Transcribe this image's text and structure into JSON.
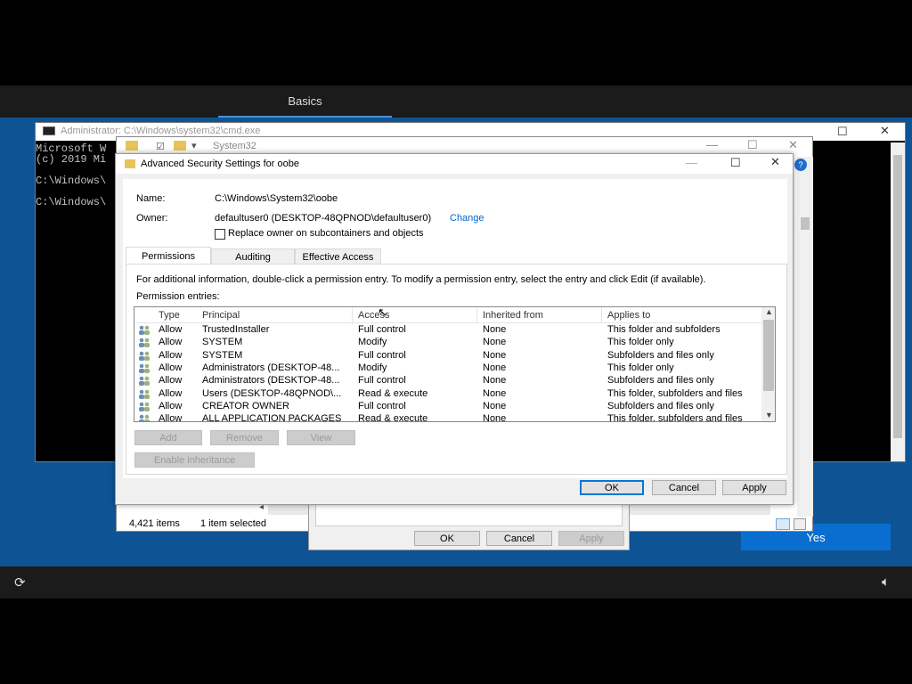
{
  "oobe": {
    "tab_label": "Basics",
    "yes_label": "Yes"
  },
  "cmd": {
    "title": "Administrator: C:\\Windows\\system32\\cmd.exe",
    "lines": [
      "Microsoft W",
      "(c) 2019 Mi",
      "",
      "C:\\Windows\\",
      "",
      "C:\\Windows\\"
    ]
  },
  "explorer": {
    "path": "System32",
    "status_items": "4,421 items",
    "status_selected": "1 item selected"
  },
  "props_dialog": {
    "ok": "OK",
    "cancel": "Cancel",
    "apply": "Apply"
  },
  "adv": {
    "title": "Advanced Security Settings for oobe",
    "name_label": "Name:",
    "name_value": "C:\\Windows\\System32\\oobe",
    "owner_label": "Owner:",
    "owner_value": "defaultuser0 (DESKTOP-48QPNOD\\defaultuser0)",
    "change_link": "Change",
    "replace_owner_label": "Replace owner on subcontainers and objects",
    "tabs": [
      "Permissions",
      "Auditing",
      "Effective Access"
    ],
    "info_text": "For additional information, double-click a permission entry. To modify a permission entry, select the entry and click Edit (if available).",
    "entries_label": "Permission entries:",
    "columns": [
      "Type",
      "Principal",
      "Access",
      "Inherited from",
      "Applies to"
    ],
    "rows": [
      [
        "Allow",
        "TrustedInstaller",
        "Full control",
        "None",
        "This folder and subfolders"
      ],
      [
        "Allow",
        "SYSTEM",
        "Modify",
        "None",
        "This folder only"
      ],
      [
        "Allow",
        "SYSTEM",
        "Full control",
        "None",
        "Subfolders and files only"
      ],
      [
        "Allow",
        "Administrators (DESKTOP-48...",
        "Modify",
        "None",
        "This folder only"
      ],
      [
        "Allow",
        "Administrators (DESKTOP-48...",
        "Full control",
        "None",
        "Subfolders and files only"
      ],
      [
        "Allow",
        "Users (DESKTOP-48QPNOD\\...",
        "Read & execute",
        "None",
        "This folder, subfolders and files"
      ],
      [
        "Allow",
        "CREATOR OWNER",
        "Full control",
        "None",
        "Subfolders and files only"
      ],
      [
        "Allow",
        "ALL APPLICATION PACKAGES",
        "Read & execute",
        "None",
        "This folder, subfolders and files"
      ]
    ],
    "add": "Add",
    "remove": "Remove",
    "view": "View",
    "enable_inheritance": "Enable inheritance",
    "ok": "OK",
    "cancel": "Cancel",
    "apply": "Apply"
  }
}
